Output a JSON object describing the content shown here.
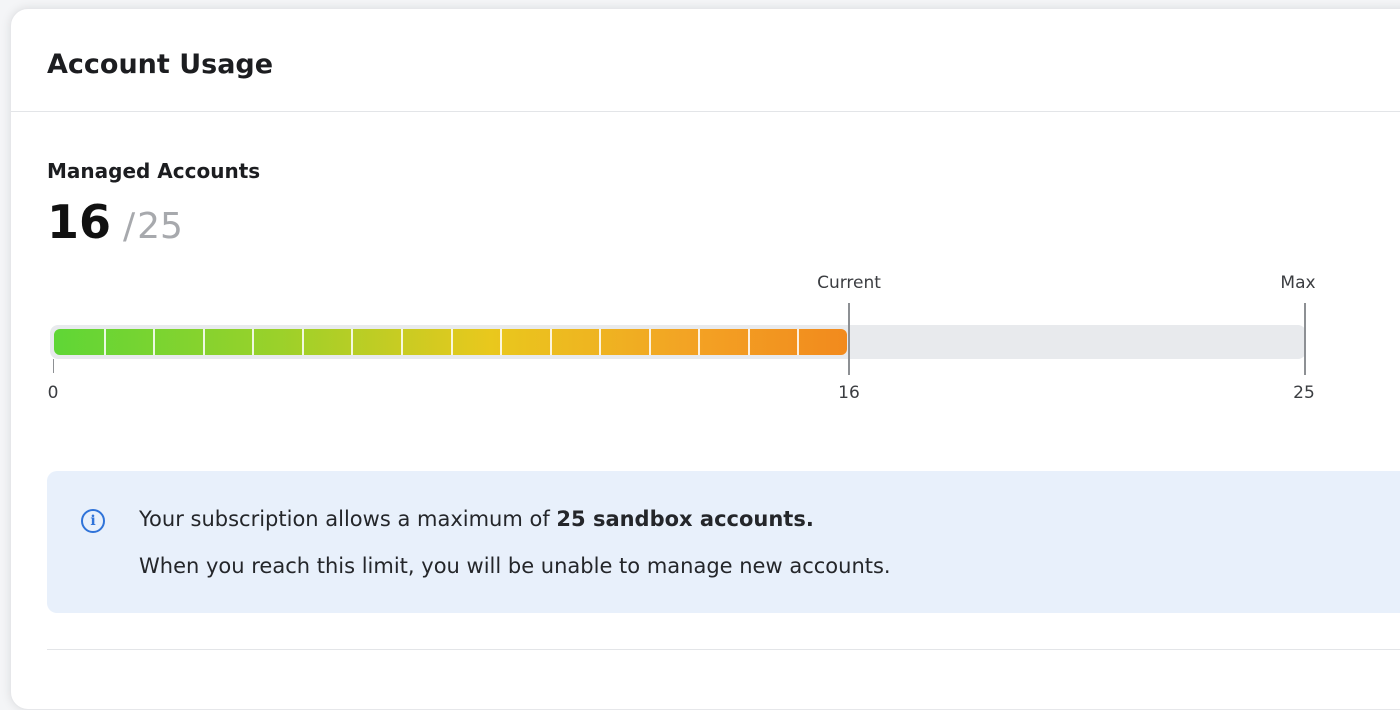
{
  "card": {
    "title": "Account Usage"
  },
  "usage": {
    "label": "Managed Accounts",
    "current": "16",
    "separator": "/",
    "max": "25",
    "current_value": 16,
    "max_value": 25,
    "min_value": 0,
    "segments_filled": 16
  },
  "bar": {
    "current_marker_label": "Current",
    "max_marker_label": "Max",
    "tick_min": "0",
    "tick_current": "16",
    "tick_max": "25",
    "colors": {
      "start": "#5fd636",
      "middle": "#e9c81d",
      "end": "#f28a1d",
      "track": "#e8eaed"
    }
  },
  "info": {
    "icon": "info-circle-icon",
    "line1_prefix": "Your subscription allows a maximum of ",
    "line1_bold": "25 sandbox accounts.",
    "line2": "When you reach this limit, you will be unable to manage new accounts.",
    "accent": "#2f73d9",
    "background": "#e8f0fb"
  }
}
